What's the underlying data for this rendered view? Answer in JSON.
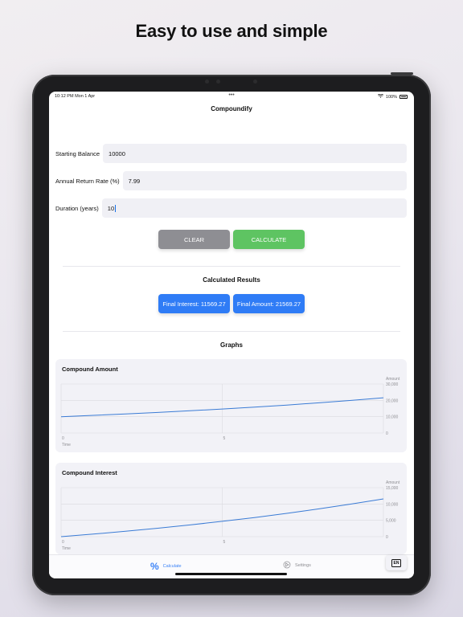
{
  "headline": "Easy to use and simple",
  "status_bar": {
    "time": "10:12 PM  Mon 1 Apr",
    "battery": "100%"
  },
  "app_title": "Compoundify",
  "form": {
    "starting_balance": {
      "label": "Starting Balance",
      "value": "10000"
    },
    "annual_return_rate": {
      "label": "Annual Return Rate (%)",
      "value": "7.99"
    },
    "duration": {
      "label": "Duration (years)",
      "value": "10"
    }
  },
  "buttons": {
    "clear": "CLEAR",
    "calculate": "CALCULATE"
  },
  "results": {
    "title": "Calculated Results",
    "final_interest": "Final Interest: 11569.27",
    "final_amount": "Final Amount: 21569.27"
  },
  "graphs_title": "Graphs",
  "chart_data": [
    {
      "type": "line",
      "title": "Compound Amount",
      "xlabel": "Time",
      "ylabel": "Amount",
      "x_ticks": [
        "0",
        "5"
      ],
      "y_ticks": [
        "30,000",
        "20,000",
        "10,000",
        "0"
      ],
      "ylim": [
        0,
        30000
      ],
      "xlim": [
        0,
        10
      ],
      "x": [
        0,
        1,
        2,
        3,
        4,
        5,
        6,
        7,
        8,
        9,
        10
      ],
      "values": [
        10000,
        10799,
        11662,
        12594,
        13600,
        14687,
        15860,
        17127,
        18496,
        19974,
        21569
      ],
      "grid": true,
      "color": "#3a7bd5"
    },
    {
      "type": "line",
      "title": "Compound Interest",
      "xlabel": "Time",
      "ylabel": "Amount",
      "x_ticks": [
        "0",
        "5"
      ],
      "y_ticks": [
        "15,000",
        "10,000",
        "5,000",
        "0"
      ],
      "ylim": [
        0,
        15000
      ],
      "xlim": [
        0,
        10
      ],
      "x": [
        0,
        1,
        2,
        3,
        4,
        5,
        6,
        7,
        8,
        9,
        10
      ],
      "values": [
        0,
        799,
        1662,
        2594,
        3600,
        4687,
        5860,
        7127,
        8496,
        9974,
        11569
      ],
      "grid": true,
      "color": "#3a7bd5"
    }
  ],
  "tabs": {
    "calculate": "Calculate",
    "settings": "Settings"
  },
  "language_button": "EN",
  "colors": {
    "accent": "#3a82f7",
    "calculate_green": "#5ec462",
    "clear_gray": "#8e8e93",
    "result_blue": "#2f7cf6"
  }
}
